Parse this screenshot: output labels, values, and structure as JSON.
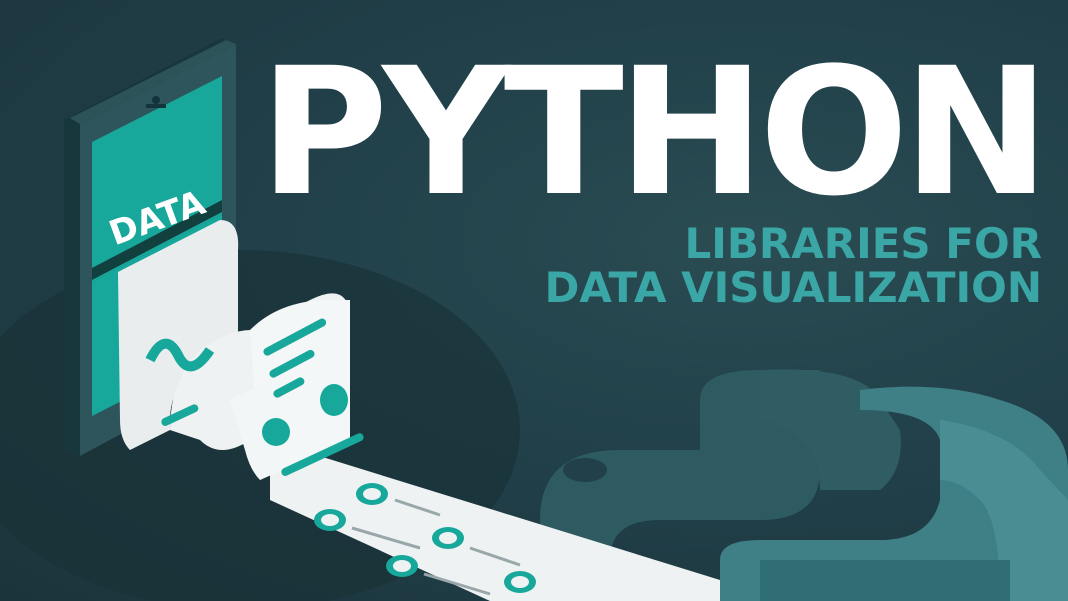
{
  "title": "PYTHON",
  "subtitle": {
    "line1": "LIBRARIES FOR",
    "line2": "DATA VISUALIZATION"
  },
  "phone": {
    "screen_label": "DATA"
  },
  "icons": {
    "logo": "python-logo-icon",
    "device": "smartphone-icon",
    "paper": "printed-report-icon"
  },
  "colors": {
    "background": "#21404a",
    "title": "#ffffff",
    "subtitle": "#3aa6a6",
    "accent": "#17a89b"
  }
}
